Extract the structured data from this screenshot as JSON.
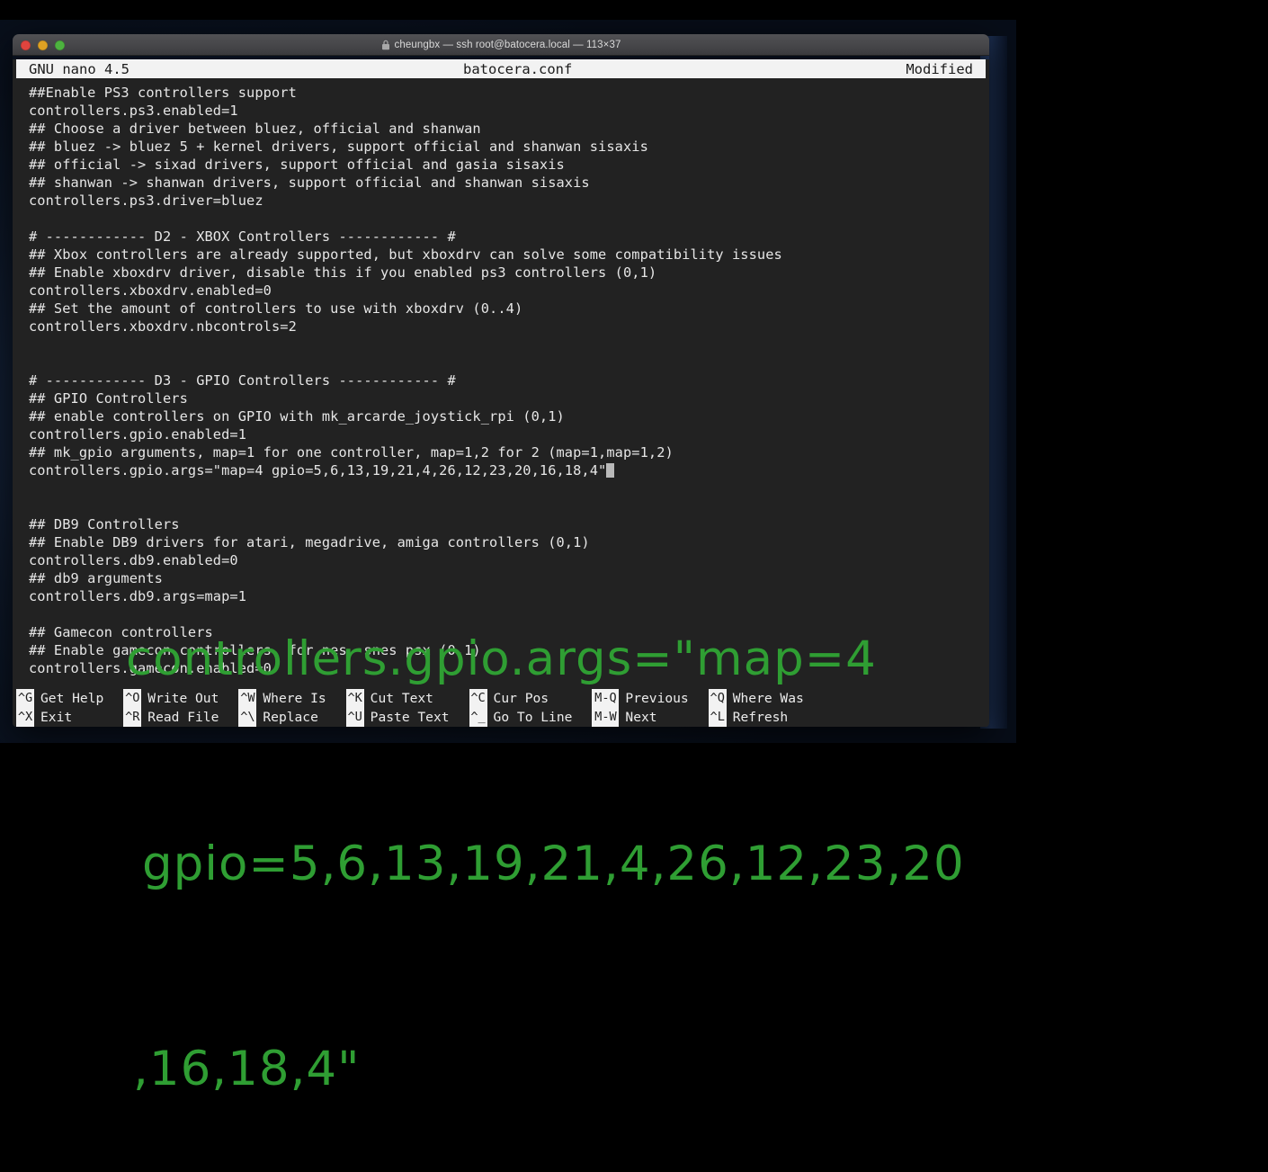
{
  "window": {
    "title": "cheungbx — ssh root@batocera.local — 113×37",
    "lock_icon": "lock-icon",
    "traffic_lights": [
      {
        "name": "close",
        "color": "#e0443e"
      },
      {
        "name": "minimize",
        "color": "#dea123"
      },
      {
        "name": "zoom",
        "color": "#4db23f"
      }
    ]
  },
  "nano": {
    "version": "GNU nano 4.5",
    "filename": "batocera.conf",
    "status": "Modified",
    "lines": [
      "##Enable PS3 controllers support",
      "controllers.ps3.enabled=1",
      "## Choose a driver between bluez, official and shanwan",
      "## bluez -> bluez 5 + kernel drivers, support official and shanwan sisaxis",
      "## official -> sixad drivers, support official and gasia sisaxis",
      "## shanwan -> shanwan drivers, support official and shanwan sisaxis",
      "controllers.ps3.driver=bluez",
      "",
      "# ------------ D2 - XBOX Controllers ------------ #",
      "## Xbox controllers are already supported, but xboxdrv can solve some compatibility issues",
      "## Enable xboxdrv driver, disable this if you enabled ps3 controllers (0,1)",
      "controllers.xboxdrv.enabled=0",
      "## Set the amount of controllers to use with xboxdrv (0..4)",
      "controllers.xboxdrv.nbcontrols=2",
      "",
      "",
      "# ------------ D3 - GPIO Controllers ------------ #",
      "## GPIO Controllers",
      "## enable controllers on GPIO with mk_arcarde_joystick_rpi (0,1)",
      "controllers.gpio.enabled=1",
      "## mk_gpio arguments, map=1 for one controller, map=1,2 for 2 (map=1,map=1,2)",
      "controllers.gpio.args=\"map=4 gpio=5,6,13,19,21,4,26,12,23,20,16,18,4\"",
      "",
      "",
      "## DB9 Controllers",
      "## Enable DB9 drivers for atari, megadrive, amiga controllers (0,1)",
      "controllers.db9.enabled=0",
      "## db9 arguments",
      "controllers.db9.args=map=1",
      "",
      "## Gamecon controllers",
      "## Enable gamecon controllers, for nes, snes psx (0,1)",
      "controllers.gamecon.enabled=0"
    ],
    "cursor_line_index": 21,
    "shortcuts": [
      {
        "key_top": "^G",
        "label_top": "Get Help",
        "key_bottom": "^X",
        "label_bottom": "Exit"
      },
      {
        "key_top": "^O",
        "label_top": "Write Out",
        "key_bottom": "^R",
        "label_bottom": "Read File"
      },
      {
        "key_top": "^W",
        "label_top": "Where Is",
        "key_bottom": "^\\",
        "label_bottom": "Replace"
      },
      {
        "key_top": "^K",
        "label_top": "Cut Text",
        "key_bottom": "^U",
        "label_bottom": "Paste Text"
      },
      {
        "key_top": "^C",
        "label_top": "Cur Pos",
        "key_bottom": "^_",
        "label_bottom": "Go To Line"
      },
      {
        "key_top": "M-Q",
        "label_top": "Previous",
        "key_bottom": "M-W",
        "label_bottom": "Next"
      },
      {
        "key_top": "^Q",
        "label_top": "Where Was",
        "key_bottom": "^L",
        "label_bottom": "Refresh"
      }
    ]
  },
  "overlay": {
    "color": "#2f9e33",
    "line1": "controllers.gpio.args=\"map=4",
    "line2": "gpio=5,6,13,19,21,4,26,12,23,20",
    "line3": ",16,18,4\""
  }
}
